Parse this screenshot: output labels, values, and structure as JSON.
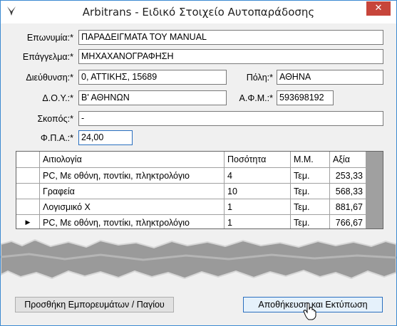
{
  "window": {
    "title": "Arbitrans - Ειδικό Στοιχείο Αυτοπαράδοσης",
    "close_glyph": "✕",
    "app_icon": "bird-logo-icon",
    "accent": "#3c8ad1"
  },
  "form": {
    "eponymia": {
      "label": "Επωνυμία:*",
      "value": "ΠΑΡΑΔΕΙΓΜΑΤΑ ΤΟΥ MANUAL"
    },
    "epaggelma": {
      "label": "Επάγγελμα:*",
      "value": "ΜΗΧΑΧΑΝΟΓΡΑΦΗΣΗ"
    },
    "dieuthynsi": {
      "label": "Διεύθυνση:*",
      "value": "0, ΑΤΤΙΚΗΣ, 15689"
    },
    "poli": {
      "label": "Πόλη:*",
      "value": "ΑΘΗΝΑ"
    },
    "doy": {
      "label": "Δ.Ο.Υ.:*",
      "value": "Β' ΑΘΗΝΩΝ"
    },
    "afm": {
      "label": "Α.Φ.Μ.:*",
      "value": "593698192"
    },
    "skopos": {
      "label": "Σκοπός:*",
      "value": "-"
    },
    "fpa": {
      "label": "Φ.Π.Α.:*",
      "value": "24,00"
    }
  },
  "grid": {
    "columns": [
      "Αιτιολογία",
      "Ποσότητα",
      "Μ.Μ.",
      "Αξία"
    ],
    "rows": [
      [
        "PC, Με οθόνη, ποντίκι, πληκτρολόγιο",
        "4",
        "Τεμ.",
        "253,33"
      ],
      [
        "Γραφεία",
        "10",
        "Τεμ.",
        "568,33"
      ],
      [
        "Λογισμικό Χ",
        "1",
        "Τεμ.",
        "881,67"
      ],
      [
        "PC, Με οθόνη, ποντίκι, πληκτρολόγιο",
        "1",
        "Τεμ.",
        "766,67"
      ]
    ],
    "current_row_marker": "▶"
  },
  "buttons": {
    "add_goods": "Προσθήκη Εμπορευμάτων / Παγίου",
    "save_print": "Αποθήκευση και Εκτύπωση"
  }
}
